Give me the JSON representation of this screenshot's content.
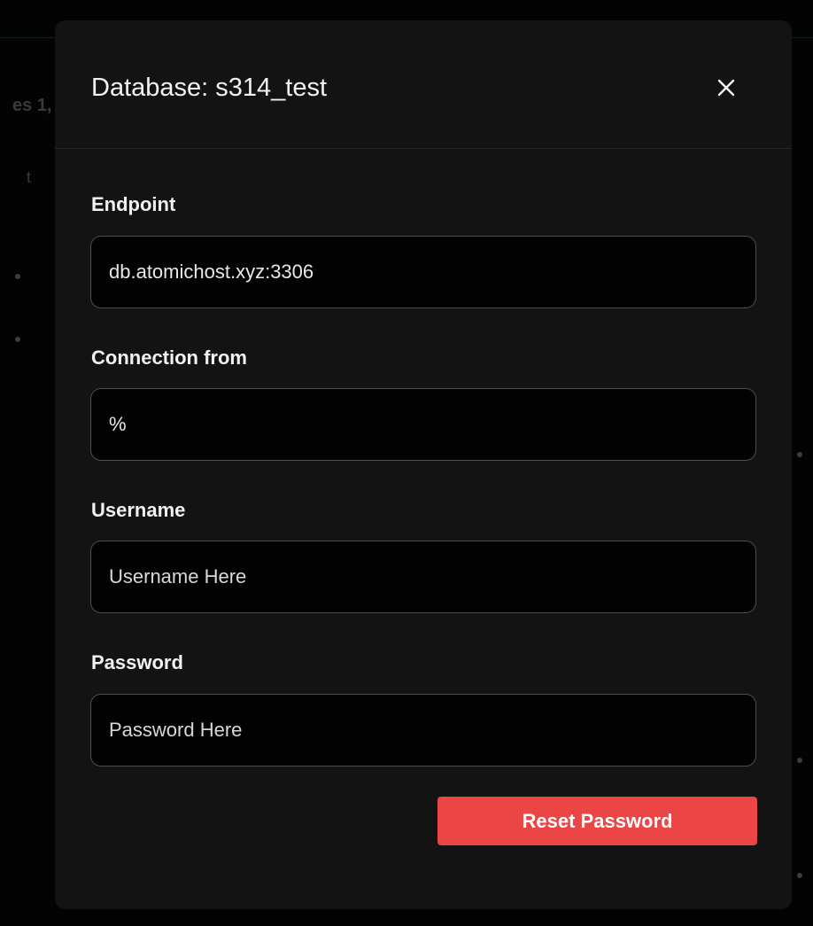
{
  "background": {
    "partial_text_1": "es 1,",
    "partial_text_2": "t"
  },
  "modal": {
    "title": "Database: s314_test",
    "close_icon": "close-icon"
  },
  "fields": {
    "endpoint": {
      "label": "Endpoint",
      "value": "db.atomichost.xyz:3306",
      "placeholder": ""
    },
    "connection_from": {
      "label": "Connection from",
      "value": "%",
      "placeholder": ""
    },
    "username": {
      "label": "Username",
      "value": "",
      "placeholder": "Username Here"
    },
    "password": {
      "label": "Password",
      "value": "",
      "placeholder": "Password Here"
    }
  },
  "actions": {
    "reset_password_label": "Reset Password"
  },
  "colors": {
    "accent": "#ec4545",
    "modal_background": "#131313",
    "input_border": "#4a4e55"
  }
}
